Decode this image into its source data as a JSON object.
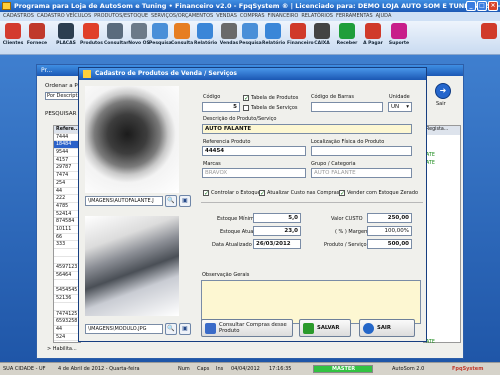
{
  "window": {
    "title": "Programa para Loja de AutoSom e Tuning • Financeiro v2.0 - FpqSystem ® | Licenciado para: DEMO LOJA AUTO SOM E TUNING v2.0 - 300912 010..."
  },
  "menu": [
    "CADASTROS",
    "CADASTRO VEÍCULOS",
    "PRODUTOS/ESTOQUE",
    "SERVIÇOS/ORÇAMENTOS",
    "VENDAS",
    "COMPRAS",
    "FINANCEIRO",
    "RELATÓRIOS",
    "FERRAMENTAS",
    "AJUDA"
  ],
  "toolbar": [
    {
      "label": "Clientes",
      "icon": "clients-icon",
      "color": "#d33b2f"
    },
    {
      "label": "Fornece",
      "icon": "supplier-icon",
      "color": "#c0392b"
    },
    {
      "label": "PLACAS",
      "icon": "plate-icon",
      "color": "#2c3e50"
    },
    {
      "label": "Produtos",
      "icon": "products-icon",
      "color": "#e0402a"
    },
    {
      "label": "Consultar",
      "icon": "search-icon",
      "color": "#5a6b7d"
    },
    {
      "label": "Novo OS",
      "icon": "new-order-icon",
      "color": "#6c7a89"
    },
    {
      "label": "Pesquisa",
      "icon": "magnifier-icon",
      "color": "#4a8fd8"
    },
    {
      "label": "Consulta",
      "icon": "document-icon",
      "color": "#e67e22"
    },
    {
      "label": "Relatório",
      "icon": "report-icon",
      "color": "#3a86d8"
    },
    {
      "label": "Vendas",
      "icon": "cash-register-icon",
      "color": "#6a6a6a"
    },
    {
      "label": "Pesquisa",
      "icon": "magnifier-icon",
      "color": "#4a8fd8"
    },
    {
      "label": "Relatório",
      "icon": "report-icon",
      "color": "#3a86d8"
    },
    {
      "label": "Financeiro",
      "icon": "money-icon",
      "color": "#d03a2a"
    },
    {
      "label": "CAIXA",
      "icon": "safe-icon",
      "color": "#444"
    },
    {
      "label": "Receber",
      "icon": "money-icon",
      "color": "#1f9e3a"
    },
    {
      "label": "A Pagar",
      "icon": "pay-icon",
      "color": "#d03a2a"
    },
    {
      "label": "Suporte",
      "icon": "support-icon",
      "color": "#c81e8a"
    },
    {
      "label": "",
      "icon": "exit-icon",
      "color": "#d03a2a"
    }
  ],
  "backwin": {
    "title": "Pr...",
    "ordenar_label": "Ordenar a Pe...",
    "ordenar_value": "Por Descript...",
    "pesq_label": "PESQUISAR",
    "grid_header": "Refere...",
    "grid_rows": [
      "7444",
      "18484",
      "9544",
      "4157",
      "29787",
      "7474",
      "254",
      "44",
      "222",
      "4785",
      "52414",
      "874584",
      "10111",
      "66",
      "333",
      "",
      "",
      "4597123",
      "56464",
      "",
      "5454545",
      "52136",
      "",
      "7474125",
      "6593258",
      "44",
      "524"
    ],
    "right_header": "Regista...",
    "right_rows": [
      "",
      "",
      "ATE",
      "ATE",
      "",
      "",
      "",
      "",
      "",
      "",
      "",
      "",
      "",
      "",
      "",
      "",
      "",
      "",
      "",
      "",
      "",
      "",
      "",
      "",
      "ATE"
    ],
    "habilitar": "> Habilita...",
    "nav_label": "Sair"
  },
  "dialog": {
    "title": "Cadastro de Produtos de Venda / Serviços",
    "img1_path": "\\IMAGENS\\AUTOFALANTE.J",
    "img2_path": "\\IMAGENS\\MODULO.JPG",
    "codigo_label": "Código",
    "codigo_value": "5",
    "tabela_produtos": "Tabela de Produtos",
    "tabela_servicos": "Tabela de Serviços",
    "codigo_barras_label": "Código de Barras",
    "unidade_label": "Unidade",
    "unidade_value": "UN",
    "descricao_label": "Descrição do Produto/Serviço",
    "descricao_value": "AUTO FALANTE",
    "referencia_label": "Referencia Produto",
    "referencia_value": "44454",
    "localizacao_label": "Localização Física do Produto",
    "marcas_label": "Marcas",
    "marcas_value": "BRAVOX",
    "grupo_label": "Grupo / Categoria",
    "grupo_value": "AUTO FALANTE",
    "controlar_estoque": "Controlar o Estoque",
    "atualizar_custo": "Atualizar Custo nas Compras",
    "vender_zerado": "Vender com Estoque Zerado",
    "estoque_minimo_label": "Estoque Mínimo",
    "estoque_minimo_value": "5,0",
    "estoque_atual_label": "Estoque Atual",
    "estoque_atual_value": "23,0",
    "data_atualizado_label": "Data Atualizado",
    "data_atualizado_value": "26/03/2012",
    "valor_custo_label": "Valor CUSTO",
    "valor_custo_value": "250,00",
    "margem_label": "( % ) Margem",
    "margem_value": "100,00%",
    "produto_servico_label": "Produto / Serviço",
    "produto_servico_value": "500,00",
    "observacao_label": "Observação Gerais",
    "consultar_compras": "Consultar Compras desse Produto",
    "salvar": "SALVAR",
    "sair": "SAIR"
  },
  "statusbar": {
    "city": "SUA CIDADE - UF",
    "date_text": "4 de Abril de 2012 - Quarta-feira",
    "num": "Num",
    "caps": "Caps",
    "ins": "Ins",
    "date": "04/04/2012",
    "time": "17:16:35",
    "progress_fraction": 1.0,
    "progress_text": "MASTER",
    "app": "AutoSom 2.0",
    "brand": "FpqSystem"
  },
  "colors": {
    "accent": "#1c59b5",
    "field_yellow": "#fdf7d2",
    "progress": "#33c242"
  }
}
